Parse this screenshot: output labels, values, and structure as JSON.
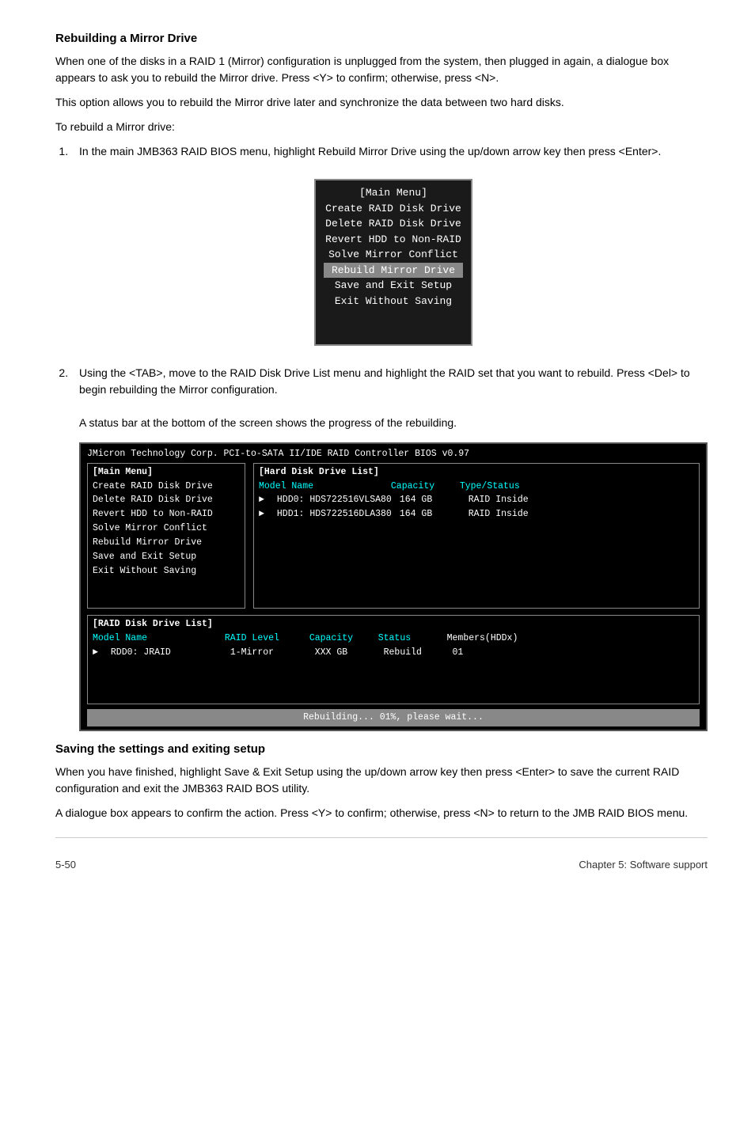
{
  "section1": {
    "title": "Rebuilding a Mirror Drive",
    "para1": "When one of the disks in a RAID 1 (Mirror) configuration is unplugged from the system, then plugged in again, a dialogue box appears to ask you to rebuild the Mirror drive. Press <Y> to confirm; otherwise, press <N>.",
    "para2": "This option allows you to rebuild the Mirror drive later and synchronize the data between two hard disks.",
    "para3": "To rebuild a Mirror drive:",
    "step1": "In the main JMB363 RAID BIOS menu, highlight Rebuild Mirror Drive using the up/down arrow key then press <Enter>.",
    "step2_part1": "Using the <TAB>, move to the RAID Disk Drive List menu and highlight the RAID set that you want to rebuild. Press <Del> to begin rebuilding the Mirror configuration.",
    "step2_part2": "A status bar at the bottom of the screen shows the progress of the rebuilding."
  },
  "main_menu_box": {
    "title": "[Main Menu]",
    "items": [
      "Create RAID Disk Drive",
      "Delete RAID Disk Drive",
      "Revert HDD to Non-RAID",
      "Solve Mirror Conflict",
      "Rebuild Mirror Drive",
      "Save and Exit Setup",
      "Exit Without Saving"
    ],
    "highlighted_index": 4
  },
  "bios_screen": {
    "top_bar": "JMicron Technology Corp.  PCI-to-SATA II/IDE RAID Controller BIOS v0.97",
    "left_panel_title": "[Main Menu]",
    "left_panel_items": [
      "Create RAID Disk Drive",
      "Delete RAID Disk Drive",
      "Revert HDD to Non-RAID",
      "Solve Mirror Conflict",
      "Rebuild Mirror Drive",
      "Save and Exit Setup",
      "Exit Without Saving"
    ],
    "right_panel_title": "[Hard Disk Drive List]",
    "right_col_headers": [
      "Model Name",
      "Capacity",
      "Type/Status"
    ],
    "right_rows": [
      {
        "arrow": "►",
        "name": "HDD0: HDS722516VLSA80",
        "capacity": "164 GB",
        "status": "RAID Inside"
      },
      {
        "arrow": "►",
        "name": "HDD1: HDS722516DLA380",
        "capacity": "164 GB",
        "status": "RAID Inside"
      }
    ],
    "raid_list_title": "[RAID Disk Drive List]",
    "raid_col_headers": [
      "Model Name",
      "RAID Level",
      "Capacity",
      "Status",
      "Members(HDDx)"
    ],
    "raid_rows": [
      {
        "arrow": "►",
        "name": "RDD0:  JRAID",
        "level": "1-Mirror",
        "capacity": "XXX GB",
        "status": "Rebuild",
        "members": "01"
      }
    ],
    "status_bar": "Rebuilding... 01%, please wait..."
  },
  "section2": {
    "title": "Saving the settings and exiting setup",
    "para1": "When you have finished, highlight Save & Exit Setup using the up/down arrow key then press <Enter> to save the current RAID configuration and exit the JMB363 RAID BOS utility.",
    "para2": "A dialogue box appears to confirm the action. Press <Y> to confirm; otherwise, press <N> to return to the JMB RAID BIOS menu."
  },
  "footer": {
    "left": "5-50",
    "right": "Chapter 5: Software support"
  }
}
